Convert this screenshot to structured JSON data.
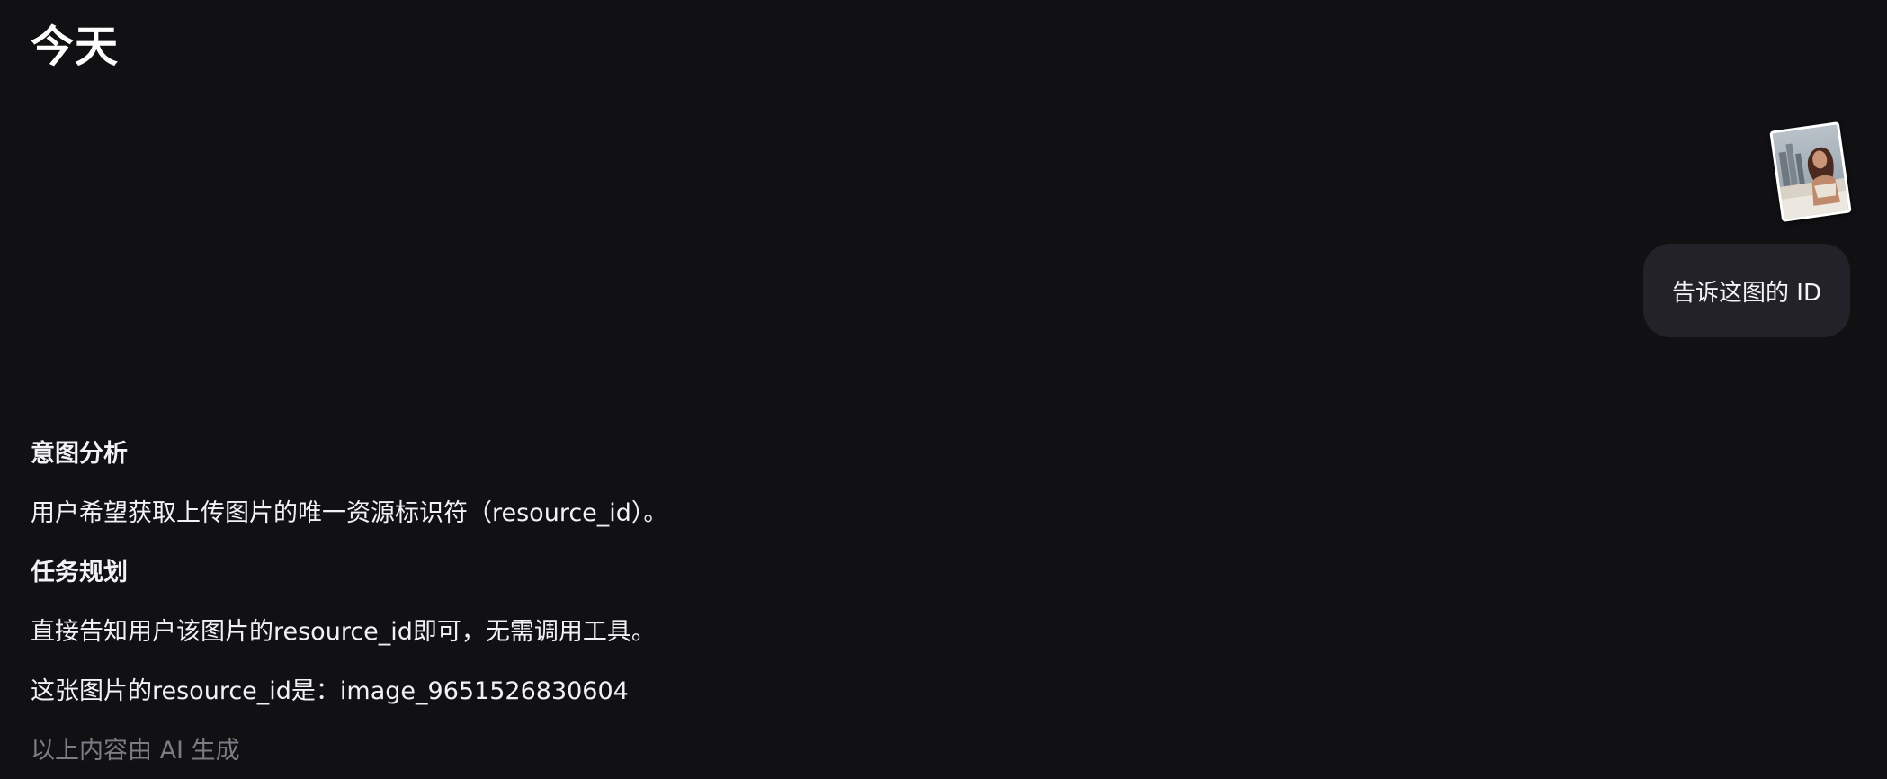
{
  "header": {
    "date_label": "今天"
  },
  "user_message": {
    "attachment_icon": "photo-thumbnail",
    "text": "告诉这图的 ID"
  },
  "assistant_reply": {
    "intent_heading": "意图分析",
    "intent_text": "用户希望获取上传图片的唯一资源标识符（resource_id）。",
    "plan_heading": "任务规划",
    "plan_text": "直接告知用户该图片的resource_id即可，无需调用工具。",
    "answer_text": "这张图片的resource_id是：image_9651526830604",
    "disclaimer": "以上内容由 AI 生成"
  },
  "colors": {
    "background": "#111113",
    "bubble": "#222228",
    "text": "#f2f2f4",
    "muted_text": "#7c7c84"
  }
}
